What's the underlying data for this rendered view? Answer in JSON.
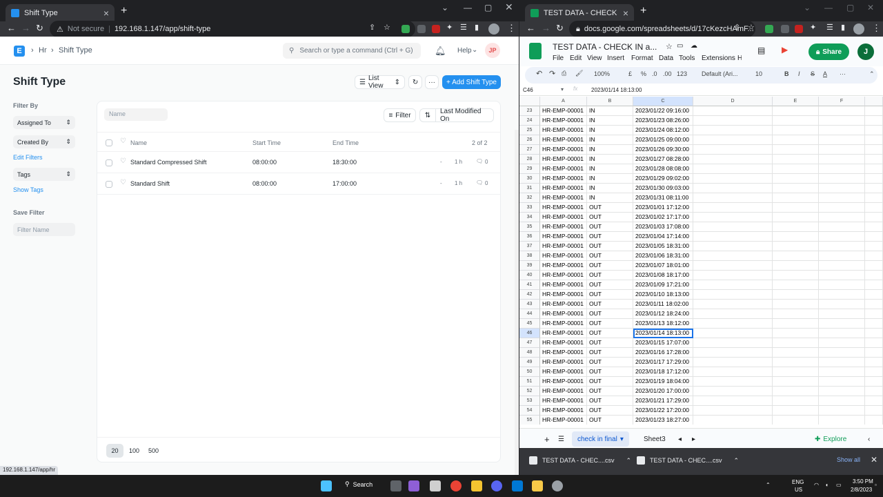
{
  "left_browser": {
    "tab_title": "Shift Type",
    "url_security": "Not secure",
    "url": "192.168.1.147/app/shift-type",
    "status_url": "192.168.1.147/app/hr"
  },
  "app": {
    "breadcrumb": [
      "Hr",
      "Shift Type"
    ],
    "search_placeholder": "Search or type a command (Ctrl + G)",
    "help_label": "Help",
    "user_initials": "JP",
    "page_title": "Shift Type",
    "list_view_label": "List View",
    "add_button_label": "+ Add Shift Type",
    "sidebar": {
      "filter_by_label": "Filter By",
      "assigned_to_label": "Assigned To",
      "created_by_label": "Created By",
      "edit_filters_label": "Edit Filters",
      "tags_label": "Tags",
      "show_tags_label": "Show Tags",
      "save_filter_label": "Save Filter",
      "filter_name_placeholder": "Filter Name"
    },
    "list": {
      "name_filter_placeholder": "Name",
      "filter_label": "Filter",
      "sort_label": "Last Modified On",
      "columns": {
        "name": "Name",
        "start": "Start Time",
        "end": "End Time"
      },
      "count": "2 of 2",
      "rows": [
        {
          "name": "Standard Compressed Shift",
          "start": "08:00:00",
          "end": "18:30:00",
          "dash": "-",
          "age": "1 h",
          "comments": "0"
        },
        {
          "name": "Standard Shift",
          "start": "08:00:00",
          "end": "17:00:00",
          "dash": "-",
          "age": "1 h",
          "comments": "0"
        }
      ],
      "page_sizes": [
        "20",
        "100",
        "500"
      ]
    }
  },
  "right_browser": {
    "tab_title": "TEST DATA - CHECK IN and Atte",
    "url": "docs.google.com/spreadsheets/d/17cKezcHAmF..."
  },
  "sheets": {
    "doc_title": "TEST DATA - CHECK IN a...",
    "menus": [
      "File",
      "Edit",
      "View",
      "Insert",
      "Format",
      "Data",
      "Tools",
      "Extensions",
      "H"
    ],
    "share_label": "Share",
    "user_initial": "J",
    "toolbar": {
      "zoom": "100%",
      "currency": "£",
      "percent": "%",
      "dec_less": ".0",
      "dec_more": ".00",
      "number_format": "123",
      "font": "Default (Ari...",
      "font_size": "10"
    },
    "name_box": "C46",
    "formula": "2023/01/14 18:13:00",
    "columns": [
      "A",
      "B",
      "C",
      "D",
      "E",
      "F"
    ],
    "rows": [
      {
        "n": "23",
        "a": "HR-EMP-00001",
        "b": "IN",
        "c": "2023/01/22 09:16:00"
      },
      {
        "n": "24",
        "a": "HR-EMP-00001",
        "b": "IN",
        "c": "2023/01/23 08:26:00"
      },
      {
        "n": "25",
        "a": "HR-EMP-00001",
        "b": "IN",
        "c": "2023/01/24 08:12:00"
      },
      {
        "n": "26",
        "a": "HR-EMP-00001",
        "b": "IN",
        "c": "2023/01/25 09:00:00"
      },
      {
        "n": "27",
        "a": "HR-EMP-00001",
        "b": "IN",
        "c": "2023/01/26 09:30:00"
      },
      {
        "n": "28",
        "a": "HR-EMP-00001",
        "b": "IN",
        "c": "2023/01/27 08:28:00"
      },
      {
        "n": "29",
        "a": "HR-EMP-00001",
        "b": "IN",
        "c": "2023/01/28 08:08:00"
      },
      {
        "n": "30",
        "a": "HR-EMP-00001",
        "b": "IN",
        "c": "2023/01/29 09:02:00"
      },
      {
        "n": "31",
        "a": "HR-EMP-00001",
        "b": "IN",
        "c": "2023/01/30 09:03:00"
      },
      {
        "n": "32",
        "a": "HR-EMP-00001",
        "b": "IN",
        "c": "2023/01/31 08:11:00"
      },
      {
        "n": "33",
        "a": "HR-EMP-00001",
        "b": "OUT",
        "c": "2023/01/01 17:12:00"
      },
      {
        "n": "34",
        "a": "HR-EMP-00001",
        "b": "OUT",
        "c": "2023/01/02 17:17:00"
      },
      {
        "n": "35",
        "a": "HR-EMP-00001",
        "b": "OUT",
        "c": "2023/01/03 17:08:00"
      },
      {
        "n": "36",
        "a": "HR-EMP-00001",
        "b": "OUT",
        "c": "2023/01/04 17:14:00"
      },
      {
        "n": "37",
        "a": "HR-EMP-00001",
        "b": "OUT",
        "c": "2023/01/05 18:31:00"
      },
      {
        "n": "38",
        "a": "HR-EMP-00001",
        "b": "OUT",
        "c": "2023/01/06 18:31:00"
      },
      {
        "n": "39",
        "a": "HR-EMP-00001",
        "b": "OUT",
        "c": "2023/01/07 18:01:00"
      },
      {
        "n": "40",
        "a": "HR-EMP-00001",
        "b": "OUT",
        "c": "2023/01/08 18:17:00"
      },
      {
        "n": "41",
        "a": "HR-EMP-00001",
        "b": "OUT",
        "c": "2023/01/09 17:21:00"
      },
      {
        "n": "42",
        "a": "HR-EMP-00001",
        "b": "OUT",
        "c": "2023/01/10 18:13:00"
      },
      {
        "n": "43",
        "a": "HR-EMP-00001",
        "b": "OUT",
        "c": "2023/01/11 18:02:00"
      },
      {
        "n": "44",
        "a": "HR-EMP-00001",
        "b": "OUT",
        "c": "2023/01/12 18:24:00"
      },
      {
        "n": "45",
        "a": "HR-EMP-00001",
        "b": "OUT",
        "c": "2023/01/13 18:12:00"
      },
      {
        "n": "46",
        "a": "HR-EMP-00001",
        "b": "OUT",
        "c": "2023/01/14 18:13:00"
      },
      {
        "n": "47",
        "a": "HR-EMP-00001",
        "b": "OUT",
        "c": "2023/01/15 17:07:00"
      },
      {
        "n": "48",
        "a": "HR-EMP-00001",
        "b": "OUT",
        "c": "2023/01/16 17:28:00"
      },
      {
        "n": "49",
        "a": "HR-EMP-00001",
        "b": "OUT",
        "c": "2023/01/17 17:29:00"
      },
      {
        "n": "50",
        "a": "HR-EMP-00001",
        "b": "OUT",
        "c": "2023/01/18 17:12:00"
      },
      {
        "n": "51",
        "a": "HR-EMP-00001",
        "b": "OUT",
        "c": "2023/01/19 18:04:00"
      },
      {
        "n": "52",
        "a": "HR-EMP-00001",
        "b": "OUT",
        "c": "2023/01/20 17:00:00"
      },
      {
        "n": "53",
        "a": "HR-EMP-00001",
        "b": "OUT",
        "c": "2023/01/21 17:29:00"
      },
      {
        "n": "54",
        "a": "HR-EMP-00001",
        "b": "OUT",
        "c": "2023/01/22 17:20:00"
      },
      {
        "n": "55",
        "a": "HR-EMP-00001",
        "b": "OUT",
        "c": "2023/01/23 18:27:00"
      }
    ],
    "selected_row": "46",
    "sheet_tabs": [
      "check in final",
      "Sheet3"
    ],
    "explore_label": "Explore"
  },
  "downloads": {
    "files": [
      "TEST DATA - CHEC....csv",
      "TEST DATA - CHEC....csv"
    ],
    "show_all_label": "Show all"
  },
  "taskbar": {
    "search_label": "Search",
    "lang": "ENG",
    "region": "US",
    "time": "3:50 PM",
    "date": "2/8/2023"
  },
  "colors": {
    "frappe_primary": "#2490ef",
    "sheets_green": "#0f9d58",
    "selection_blue": "#1a73e8"
  }
}
